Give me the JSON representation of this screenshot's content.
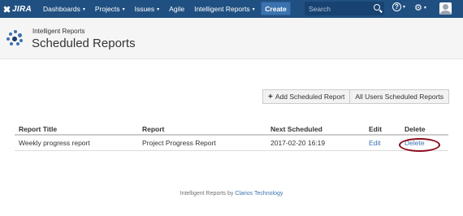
{
  "nav": {
    "logo_text": "JIRA",
    "items": [
      {
        "label": "Dashboards",
        "caret": true
      },
      {
        "label": "Projects",
        "caret": true
      },
      {
        "label": "Issues",
        "caret": true
      },
      {
        "label": "Agile",
        "caret": false
      },
      {
        "label": "Intelligent Reports",
        "caret": true
      }
    ],
    "create_label": "Create",
    "search_placeholder": "Search",
    "help_icon": "?",
    "gear_icon": "⚙",
    "caret": "▾"
  },
  "header": {
    "app_name": "Intelligent Reports",
    "page_title": "Scheduled Reports"
  },
  "actions": {
    "add_label": "Add Scheduled Report",
    "add_icon": "+",
    "all_users_label": "All Users Scheduled Reports"
  },
  "table": {
    "headers": {
      "title": "Report Title",
      "report": "Report",
      "next": "Next Scheduled",
      "edit": "Edit",
      "delete": "Delete"
    },
    "rows": [
      {
        "title": "Weekly progress report",
        "report": "Project Progress Report",
        "next": "2017-02-20 16:19",
        "edit": "Edit",
        "delete": "Delete"
      }
    ]
  },
  "footer": {
    "text": "Intelligent Reports by",
    "company": "Clarios Technology"
  },
  "colors": {
    "nav_bg": "#205081",
    "create_bg": "#3b73af",
    "link": "#3b73af",
    "highlight": "#8b0c1e"
  }
}
